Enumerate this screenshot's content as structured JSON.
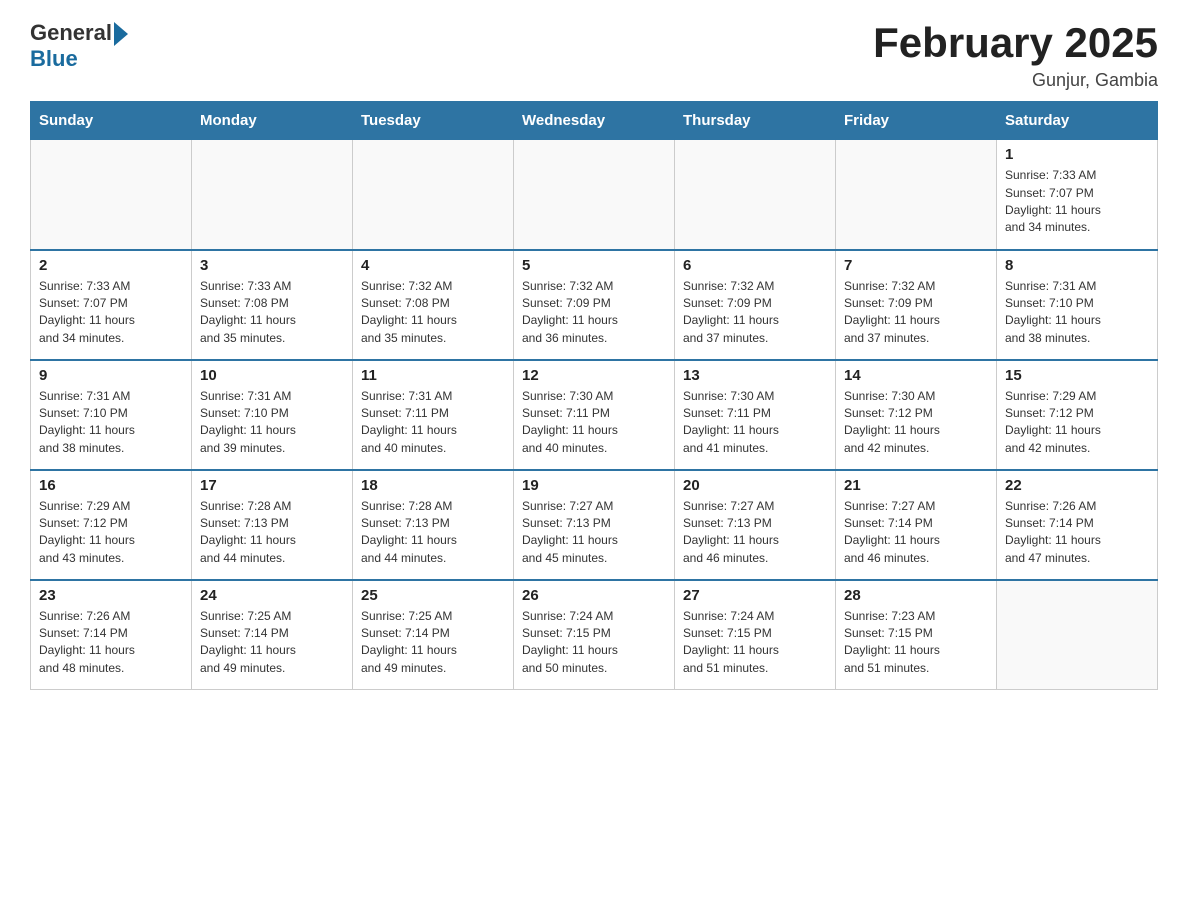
{
  "header": {
    "logo_general": "General",
    "logo_blue": "Blue",
    "month_title": "February 2025",
    "location": "Gunjur, Gambia"
  },
  "days_of_week": [
    "Sunday",
    "Monday",
    "Tuesday",
    "Wednesday",
    "Thursday",
    "Friday",
    "Saturday"
  ],
  "weeks": [
    [
      {
        "day": "",
        "info": ""
      },
      {
        "day": "",
        "info": ""
      },
      {
        "day": "",
        "info": ""
      },
      {
        "day": "",
        "info": ""
      },
      {
        "day": "",
        "info": ""
      },
      {
        "day": "",
        "info": ""
      },
      {
        "day": "1",
        "info": "Sunrise: 7:33 AM\nSunset: 7:07 PM\nDaylight: 11 hours\nand 34 minutes."
      }
    ],
    [
      {
        "day": "2",
        "info": "Sunrise: 7:33 AM\nSunset: 7:07 PM\nDaylight: 11 hours\nand 34 minutes."
      },
      {
        "day": "3",
        "info": "Sunrise: 7:33 AM\nSunset: 7:08 PM\nDaylight: 11 hours\nand 35 minutes."
      },
      {
        "day": "4",
        "info": "Sunrise: 7:32 AM\nSunset: 7:08 PM\nDaylight: 11 hours\nand 35 minutes."
      },
      {
        "day": "5",
        "info": "Sunrise: 7:32 AM\nSunset: 7:09 PM\nDaylight: 11 hours\nand 36 minutes."
      },
      {
        "day": "6",
        "info": "Sunrise: 7:32 AM\nSunset: 7:09 PM\nDaylight: 11 hours\nand 37 minutes."
      },
      {
        "day": "7",
        "info": "Sunrise: 7:32 AM\nSunset: 7:09 PM\nDaylight: 11 hours\nand 37 minutes."
      },
      {
        "day": "8",
        "info": "Sunrise: 7:31 AM\nSunset: 7:10 PM\nDaylight: 11 hours\nand 38 minutes."
      }
    ],
    [
      {
        "day": "9",
        "info": "Sunrise: 7:31 AM\nSunset: 7:10 PM\nDaylight: 11 hours\nand 38 minutes."
      },
      {
        "day": "10",
        "info": "Sunrise: 7:31 AM\nSunset: 7:10 PM\nDaylight: 11 hours\nand 39 minutes."
      },
      {
        "day": "11",
        "info": "Sunrise: 7:31 AM\nSunset: 7:11 PM\nDaylight: 11 hours\nand 40 minutes."
      },
      {
        "day": "12",
        "info": "Sunrise: 7:30 AM\nSunset: 7:11 PM\nDaylight: 11 hours\nand 40 minutes."
      },
      {
        "day": "13",
        "info": "Sunrise: 7:30 AM\nSunset: 7:11 PM\nDaylight: 11 hours\nand 41 minutes."
      },
      {
        "day": "14",
        "info": "Sunrise: 7:30 AM\nSunset: 7:12 PM\nDaylight: 11 hours\nand 42 minutes."
      },
      {
        "day": "15",
        "info": "Sunrise: 7:29 AM\nSunset: 7:12 PM\nDaylight: 11 hours\nand 42 minutes."
      }
    ],
    [
      {
        "day": "16",
        "info": "Sunrise: 7:29 AM\nSunset: 7:12 PM\nDaylight: 11 hours\nand 43 minutes."
      },
      {
        "day": "17",
        "info": "Sunrise: 7:28 AM\nSunset: 7:13 PM\nDaylight: 11 hours\nand 44 minutes."
      },
      {
        "day": "18",
        "info": "Sunrise: 7:28 AM\nSunset: 7:13 PM\nDaylight: 11 hours\nand 44 minutes."
      },
      {
        "day": "19",
        "info": "Sunrise: 7:27 AM\nSunset: 7:13 PM\nDaylight: 11 hours\nand 45 minutes."
      },
      {
        "day": "20",
        "info": "Sunrise: 7:27 AM\nSunset: 7:13 PM\nDaylight: 11 hours\nand 46 minutes."
      },
      {
        "day": "21",
        "info": "Sunrise: 7:27 AM\nSunset: 7:14 PM\nDaylight: 11 hours\nand 46 minutes."
      },
      {
        "day": "22",
        "info": "Sunrise: 7:26 AM\nSunset: 7:14 PM\nDaylight: 11 hours\nand 47 minutes."
      }
    ],
    [
      {
        "day": "23",
        "info": "Sunrise: 7:26 AM\nSunset: 7:14 PM\nDaylight: 11 hours\nand 48 minutes."
      },
      {
        "day": "24",
        "info": "Sunrise: 7:25 AM\nSunset: 7:14 PM\nDaylight: 11 hours\nand 49 minutes."
      },
      {
        "day": "25",
        "info": "Sunrise: 7:25 AM\nSunset: 7:14 PM\nDaylight: 11 hours\nand 49 minutes."
      },
      {
        "day": "26",
        "info": "Sunrise: 7:24 AM\nSunset: 7:15 PM\nDaylight: 11 hours\nand 50 minutes."
      },
      {
        "day": "27",
        "info": "Sunrise: 7:24 AM\nSunset: 7:15 PM\nDaylight: 11 hours\nand 51 minutes."
      },
      {
        "day": "28",
        "info": "Sunrise: 7:23 AM\nSunset: 7:15 PM\nDaylight: 11 hours\nand 51 minutes."
      },
      {
        "day": "",
        "info": ""
      }
    ]
  ]
}
